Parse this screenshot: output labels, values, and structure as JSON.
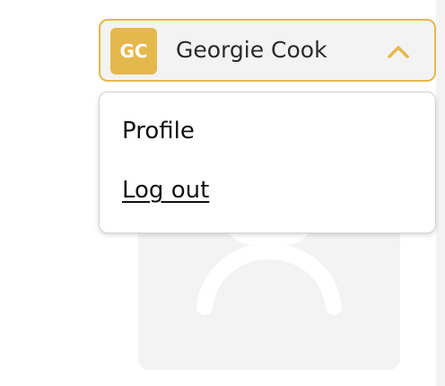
{
  "user": {
    "initials": "GC",
    "name": "Georgie Cook",
    "avatar_color": "#e5b84d"
  },
  "trigger": {
    "expanded": true,
    "chevron_icon": "chevron-up-icon",
    "border_color": "#e5b84d"
  },
  "menu": {
    "items": [
      {
        "label": "Profile"
      },
      {
        "label": "Log out"
      }
    ]
  },
  "placeholder": {
    "icon": "user-placeholder-icon"
  }
}
